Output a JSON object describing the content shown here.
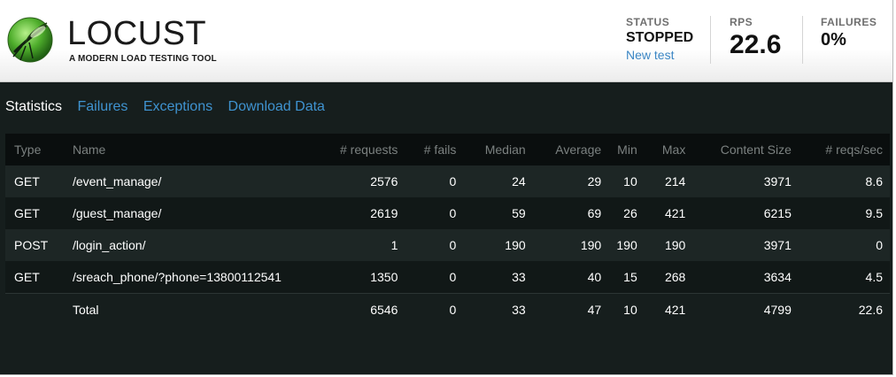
{
  "app": {
    "logo_text": "LOCUST",
    "tagline": "A MODERN LOAD TESTING TOOL"
  },
  "status": {
    "label": "STATUS",
    "value": "STOPPED",
    "new_test_link": "New test"
  },
  "rps": {
    "label": "RPS",
    "value": "22.6"
  },
  "failures": {
    "label": "FAILURES",
    "value": "0%"
  },
  "tabs": [
    {
      "label": "Statistics",
      "active": true
    },
    {
      "label": "Failures",
      "active": false
    },
    {
      "label": "Exceptions",
      "active": false
    },
    {
      "label": "Download Data",
      "active": false
    }
  ],
  "table": {
    "headers": [
      "Type",
      "Name",
      "# requests",
      "# fails",
      "Median",
      "Average",
      "Min",
      "Max",
      "Content Size",
      "# reqs/sec"
    ],
    "rows": [
      [
        "GET",
        "/event_manage/",
        "2576",
        "0",
        "24",
        "29",
        "10",
        "214",
        "3971",
        "8.6"
      ],
      [
        "GET",
        "/guest_manage/",
        "2619",
        "0",
        "59",
        "69",
        "26",
        "421",
        "6215",
        "9.5"
      ],
      [
        "POST",
        "/login_action/",
        "1",
        "0",
        "190",
        "190",
        "190",
        "190",
        "3971",
        "0"
      ],
      [
        "GET",
        "/sreach_phone/?phone=13800112541",
        "1350",
        "0",
        "33",
        "40",
        "15",
        "268",
        "3634",
        "4.5"
      ]
    ],
    "total": [
      "",
      "Total",
      "6546",
      "0",
      "33",
      "47",
      "10",
      "421",
      "4799",
      "22.6"
    ]
  },
  "colors": {
    "link_blue": "#3f93d0",
    "dark_background": "#161e1d",
    "logo_green": "#5bb83a"
  }
}
